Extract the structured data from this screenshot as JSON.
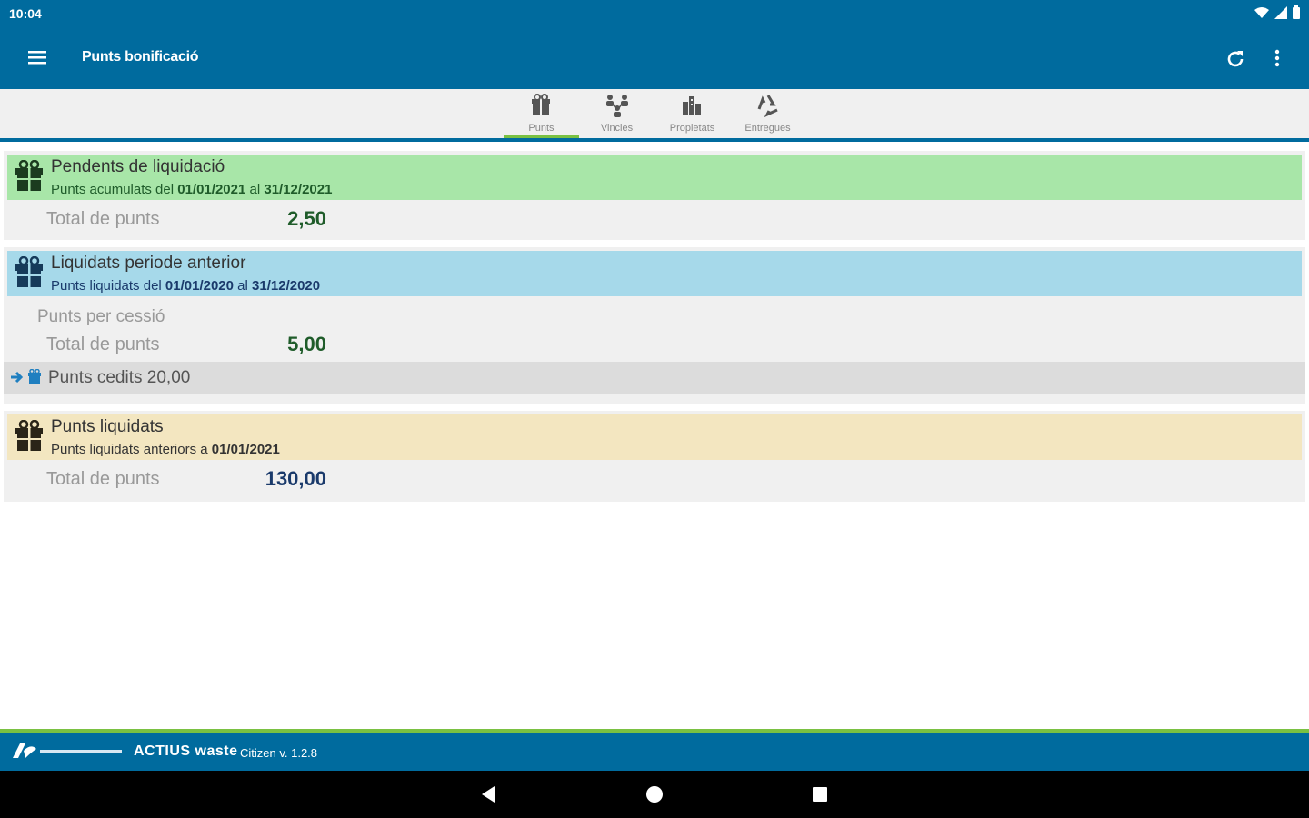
{
  "status_bar": {
    "time": "10:04",
    "icons": [
      "wifi-icon",
      "signal-icon",
      "battery-icon"
    ]
  },
  "app_bar": {
    "title": "Punts bonificació",
    "menu_icon": "hamburger-icon",
    "actions": [
      "refresh-icon",
      "more-vert-icon"
    ]
  },
  "tabs": [
    {
      "label": "Punts",
      "icon": "gift-icon",
      "active": true
    },
    {
      "label": "Vincles",
      "icon": "people-link-icon",
      "active": false
    },
    {
      "label": "Propietats",
      "icon": "buildings-icon",
      "active": false
    },
    {
      "label": "Entregues",
      "icon": "recycle-icon",
      "active": false
    }
  ],
  "pending": {
    "title": "Pendents de liquidació",
    "subtitle_prefix": "Punts acumulats del",
    "from": "01/01/2021",
    "joiner": "al",
    "to": "31/12/2021",
    "total_label": "Total de punts",
    "total_value": "2,50",
    "color": "#a8e6a8"
  },
  "previous": {
    "title": "Liquidats periode anterior",
    "subtitle_prefix": "Punts liquidats del",
    "from": "01/01/2020",
    "joiner": "al",
    "to": "31/12/2020",
    "cession_label": "Punts per cessió",
    "total_label": "Total de punts",
    "total_value": "5,00",
    "ceded_text": "Punts cedits 20,00",
    "color": "#a6d9ea"
  },
  "liquidated": {
    "title": "Punts liquidats",
    "subtitle_prefix": "Punts liquidats anteriors a",
    "date": "01/01/2021",
    "total_label": "Total de punts",
    "total_value": "130,00",
    "color": "#f3e6c0"
  },
  "footer": {
    "brand": "ACTIUS waste",
    "version": "Citizen v. 1.2.8"
  },
  "colors": {
    "primary": "#006b9e",
    "accent": "#7ac142",
    "green_text": "#1f5c2a",
    "blue_text": "#1a3a6b"
  }
}
